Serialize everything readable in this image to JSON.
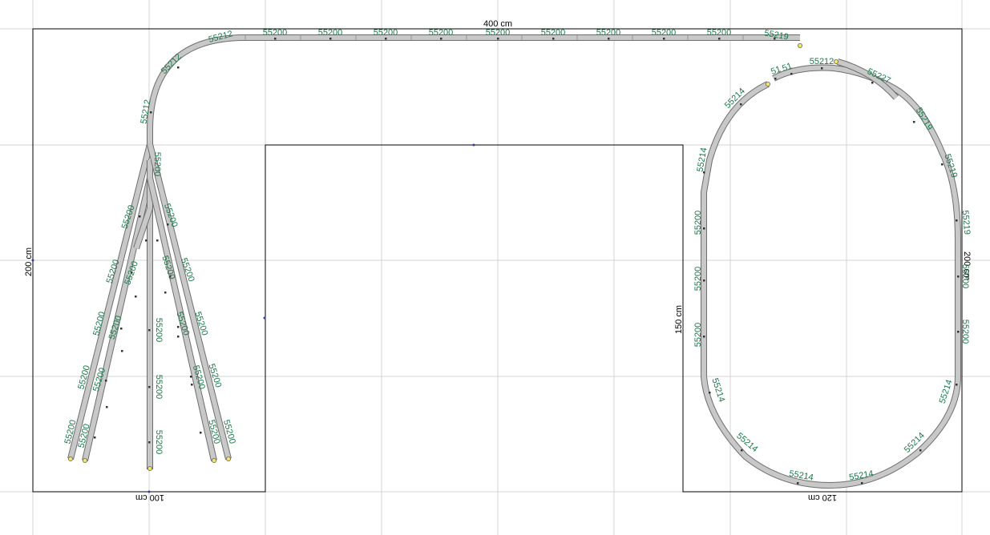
{
  "dimensions": {
    "top_width": "400 cm",
    "left_height": "200 cm",
    "bottom_left_width": "100 cm",
    "middle_height": "150 cm",
    "bottom_right_width": "120 cm",
    "right_height": "200 cm"
  },
  "labels": {
    "straight": "55200",
    "curve_r1": "55212",
    "curve_r2": "55214",
    "curve_r3": "55219",
    "switch": "55227",
    "short": "51"
  },
  "colors": {
    "grid": "#d4d4d4",
    "track_fill": "#c8c8c8",
    "track_edge": "#6e6e6e",
    "label": "#1a7a4a",
    "endpoint": "#f5e663"
  }
}
